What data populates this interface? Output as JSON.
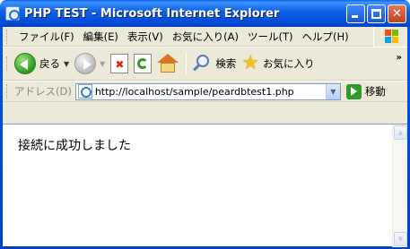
{
  "window": {
    "title": "PHP TEST - Microsoft Internet Explorer"
  },
  "menubar": {
    "items": [
      "ファイル(F)",
      "編集(E)",
      "表示(V)",
      "お気に入り(A)",
      "ツール(T)",
      "ヘルプ(H)"
    ]
  },
  "toolbar": {
    "back_label": "戻る",
    "search_label": "検索",
    "favorites_label": "お気に入り"
  },
  "address": {
    "label": "アドレス(D)",
    "url": "http://localhost/sample/peardbtest1.php",
    "go_label": "移動"
  },
  "content": {
    "message": "接続に成功しました"
  }
}
